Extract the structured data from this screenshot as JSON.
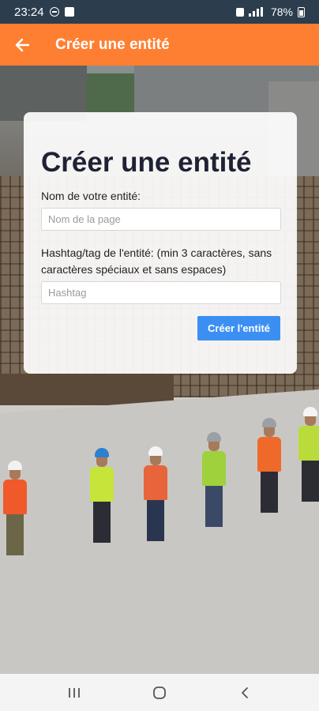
{
  "status_bar": {
    "time": "23:24",
    "battery": "78%",
    "icons": [
      "do-not-disturb-icon",
      "message-icon",
      "lock-icon",
      "signal-icon",
      "battery-icon"
    ]
  },
  "app_bar": {
    "title": "Créer une entité",
    "back_icon": "arrow-back-icon",
    "color": "#ff7f32"
  },
  "form": {
    "heading": "Créer une entité",
    "name_label": "Nom de votre entité:",
    "name_value": "",
    "name_placeholder": "Nom de la page",
    "hashtag_label": "Hashtag/tag de l'entité: (min 3 caractères, sans caractères spéciaux et sans espaces)",
    "hashtag_value": "",
    "hashtag_placeholder": "Hashtag",
    "submit_label": "Créer l'entité",
    "submit_color": "#3b8ff3"
  },
  "nav_bar": {
    "icons": [
      "recent-apps-icon",
      "home-icon",
      "back-nav-icon"
    ]
  }
}
